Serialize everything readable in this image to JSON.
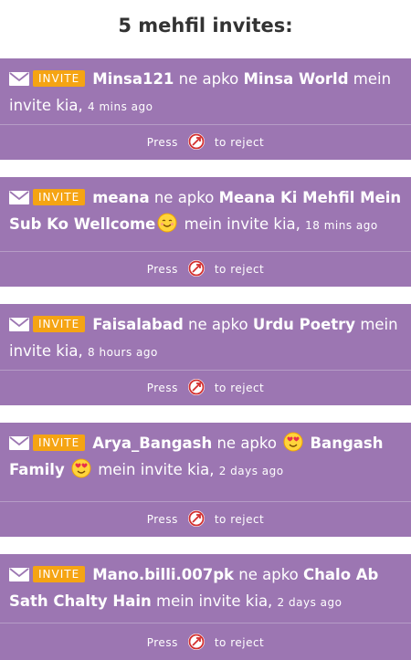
{
  "header": {
    "title": "5 mehfil invites:"
  },
  "invites": [
    {
      "badge": "INVITE",
      "user": "Minsa121",
      "connector": "ne apko",
      "room": "Minsa World",
      "suffix": "mein invite kia,",
      "time": "4 mins ago",
      "reject_prefix": "Press",
      "reject_suffix": "to reject"
    },
    {
      "badge": "INVITE",
      "user": "meana",
      "connector": "ne apko",
      "room": "Meana Ki Mehfil Mein Sub Ko Wellcome",
      "room_emoji": "smiling-face-icon",
      "suffix": "mein invite kia,",
      "time": "18 mins ago",
      "reject_prefix": "Press",
      "reject_suffix": "to reject"
    },
    {
      "badge": "INVITE",
      "user": "Faisalabad",
      "connector": "ne apko",
      "room": "Urdu Poetry",
      "suffix": "mein invite kia,",
      "time": "8 hours ago",
      "reject_prefix": "Press",
      "reject_suffix": "to reject"
    },
    {
      "badge": "INVITE",
      "user": "Arya_Bangash",
      "connector": "ne apko",
      "room_prefix_emoji": "heart-eyes-face-icon",
      "room": "Bangash Family",
      "room_emoji": "heart-eyes-face-icon",
      "suffix": "mein invite kia,",
      "time": "2 days ago",
      "reject_prefix": "Press",
      "reject_suffix": "to reject"
    },
    {
      "badge": "INVITE",
      "user": "Mano.billi.007pk",
      "connector": "ne apko",
      "room": "Chalo Ab Sath Chalty Hain",
      "suffix": "mein invite kia,",
      "time": "2 days ago",
      "reject_prefix": "Press",
      "reject_suffix": "to reject"
    }
  ],
  "colors": {
    "card_background": "#9c76b2",
    "badge_background": "#f5a413",
    "reject_icon": "#d32f2f",
    "title_text": "#333333"
  }
}
